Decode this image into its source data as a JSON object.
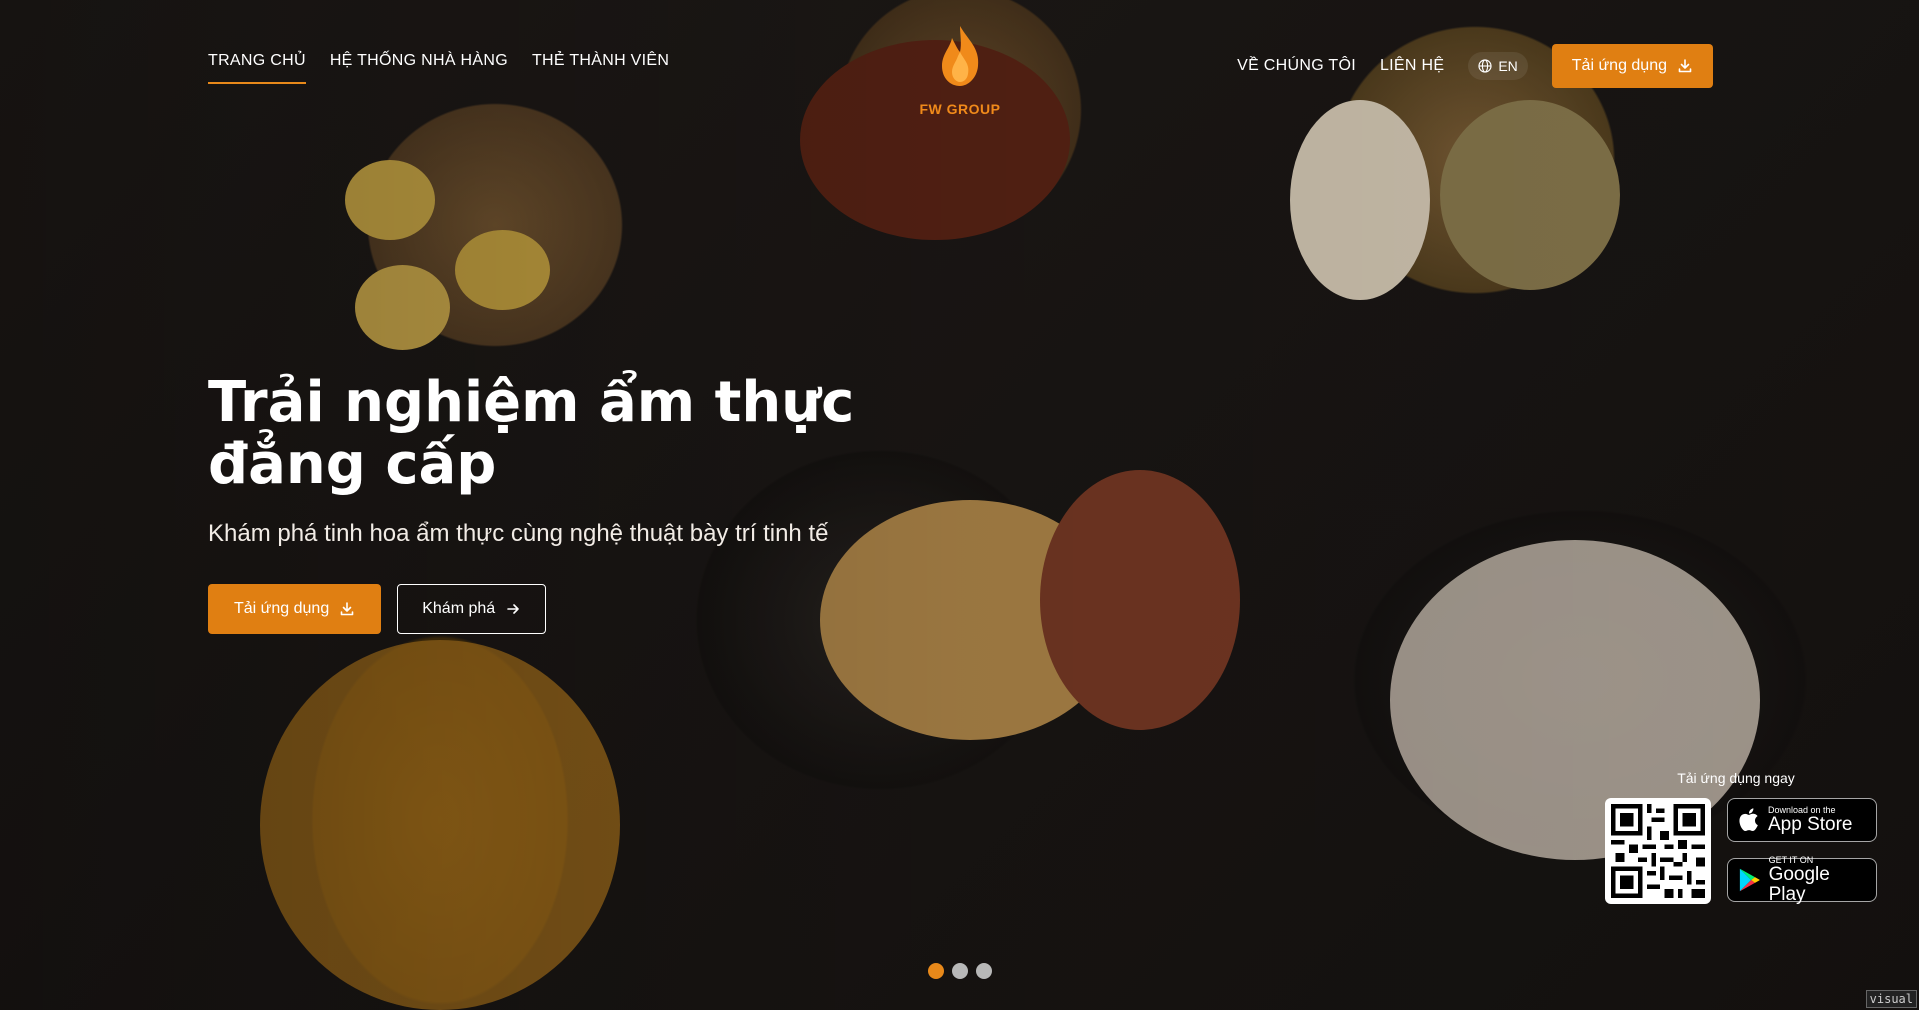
{
  "nav": {
    "left_links": [
      {
        "label": "TRANG CHỦ",
        "active": true
      },
      {
        "label": "HỆ THỐNG NHÀ HÀNG",
        "active": false
      },
      {
        "label": "THẺ THÀNH VIÊN",
        "active": false
      }
    ],
    "right_links": [
      {
        "label": "VỀ CHÚNG TÔI"
      },
      {
        "label": "LIÊN HỆ"
      }
    ],
    "language": "EN",
    "download_label": "Tải ứng dụng"
  },
  "logo": {
    "text": "FW GROUP"
  },
  "hero": {
    "title_line1": "Trải nghiệm ẩm thực",
    "title_line2": "đẳng cấp",
    "subtitle": "Khám phá tinh hoa ẩm thực cùng nghệ thuật bày trí tinh tế",
    "download_label": "Tải ứng dụng",
    "explore_label": "Khám phá"
  },
  "app_download": {
    "label": "Tải ứng dụng ngay",
    "app_store": {
      "small": "Download on the",
      "big": "App Store"
    },
    "google_play": {
      "small": "GET IT ON",
      "big": "Google Play"
    }
  },
  "slider": {
    "count": 3,
    "active_index": 0
  },
  "corner_tag": "visual",
  "colors": {
    "accent": "#e07f12",
    "active_underline": "#e8891a"
  }
}
